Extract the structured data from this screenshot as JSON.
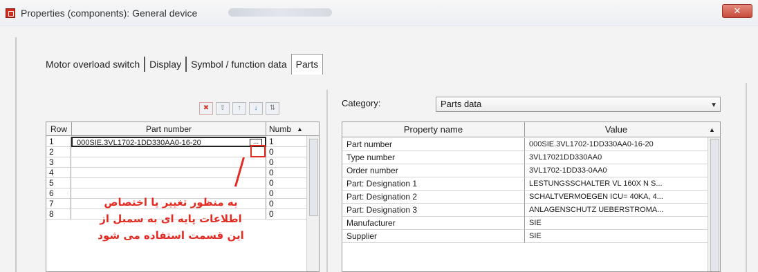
{
  "window": {
    "title": "Properties (components): General device",
    "close_glyph": "✕"
  },
  "tabs": [
    {
      "label": "Motor overload switch",
      "active": false
    },
    {
      "label": "Display",
      "active": false
    },
    {
      "label": "Symbol / function data",
      "active": false
    },
    {
      "label": "Parts",
      "active": true
    }
  ],
  "toolbar": {
    "buttons": [
      {
        "name": "delete-row-button",
        "glyph": "✖"
      },
      {
        "name": "insert-row-button",
        "glyph": "⇧"
      },
      {
        "name": "move-up-button",
        "glyph": "↑"
      },
      {
        "name": "move-down-button",
        "glyph": "↓"
      },
      {
        "name": "sort-button",
        "glyph": "⇅"
      }
    ]
  },
  "parts_table": {
    "headers": {
      "row": "Row",
      "part": "Part number",
      "num": "Numb"
    },
    "sort_glyph": "▲",
    "rows": [
      {
        "row": "1",
        "part": "000SIE.3VL1702-1DD330AA0-16-20",
        "num": "1"
      },
      {
        "row": "2",
        "part": "",
        "num": "0"
      },
      {
        "row": "3",
        "part": "",
        "num": "0"
      },
      {
        "row": "4",
        "part": "",
        "num": "0"
      },
      {
        "row": "5",
        "part": "",
        "num": "0"
      },
      {
        "row": "6",
        "part": "",
        "num": "0"
      },
      {
        "row": "7",
        "part": "",
        "num": "0"
      },
      {
        "row": "8",
        "part": "",
        "num": "0"
      }
    ],
    "ellipsis": "..."
  },
  "annotation": {
    "line1": "به منظور تغییر یا اختصاص",
    "line2": "اطلاعات پایه ای به سمبل از",
    "line3": "این قسمت استفاده می شود",
    "color": "#e32b22"
  },
  "category": {
    "label": "Category:",
    "value": "Parts data",
    "arrow": "▼"
  },
  "properties_table": {
    "headers": {
      "name": "Property name",
      "value": "Value"
    },
    "sort_glyph": "▲",
    "rows": [
      {
        "name": "Part number",
        "value": "000SIE.3VL1702-1DD330AA0-16-20"
      },
      {
        "name": "Type number",
        "value": "3VL17021DD330AA0"
      },
      {
        "name": "Order number",
        "value": "3VL1702-1DD33-0AA0"
      },
      {
        "name": "Part: Designation 1",
        "value": "LESTUNGSSCHALTER VL 160X N S..."
      },
      {
        "name": "Part: Designation 2",
        "value": "SCHALTVERMOEGEN ICU= 40KA, 4..."
      },
      {
        "name": "Part: Designation 3",
        "value": "ANLAGENSCHUTZ UEBERSTROMA..."
      },
      {
        "name": "Manufacturer",
        "value": "SIE"
      },
      {
        "name": "Supplier",
        "value": "SIE"
      }
    ]
  }
}
